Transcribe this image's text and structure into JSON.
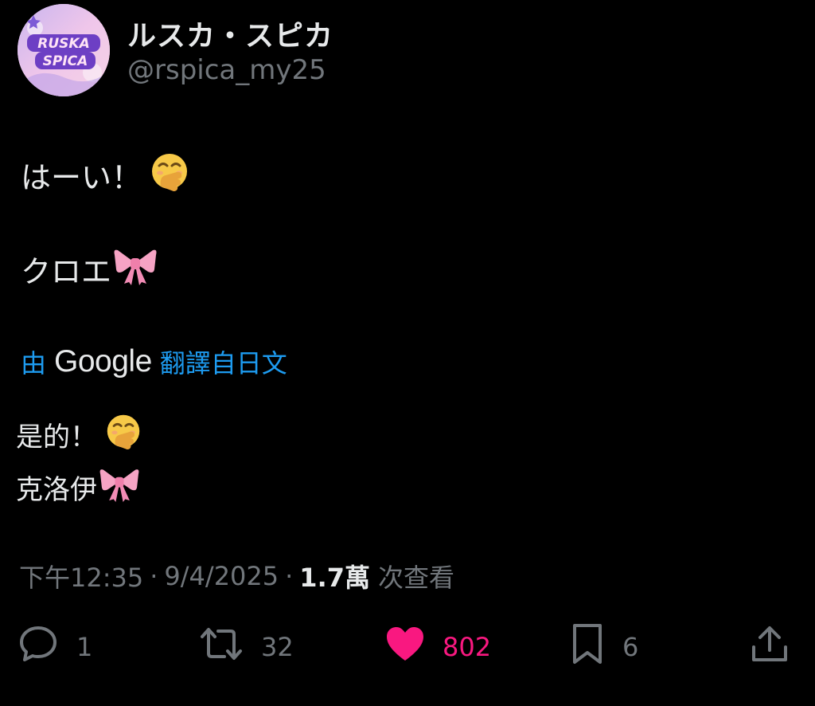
{
  "author": {
    "name": "ルスカ・スピカ",
    "handle": "@rspica_my25",
    "avatar_text": "RUSKA SPICA"
  },
  "post": {
    "line1": "はーい！",
    "line2": "クロエ",
    "emoji1": "hand-over-mouth-face-icon",
    "emoji2": "pink-ribbon-icon"
  },
  "translation": {
    "by": "由",
    "provider": "Google",
    "label": "翻譯自日文",
    "line1": "是的！",
    "line2": "克洛伊"
  },
  "meta": {
    "time": "下午12:35",
    "date": "9/4/2025",
    "views": "1.7萬",
    "views_label": "次查看",
    "separator": "·"
  },
  "actions": {
    "replies": "1",
    "retweets": "32",
    "likes": "802",
    "bookmarks": "6"
  },
  "colors": {
    "background": "#000000",
    "text": "#e7e9ea",
    "secondary": "#71767b",
    "link": "#1d9bf0",
    "like": "#f91880"
  }
}
